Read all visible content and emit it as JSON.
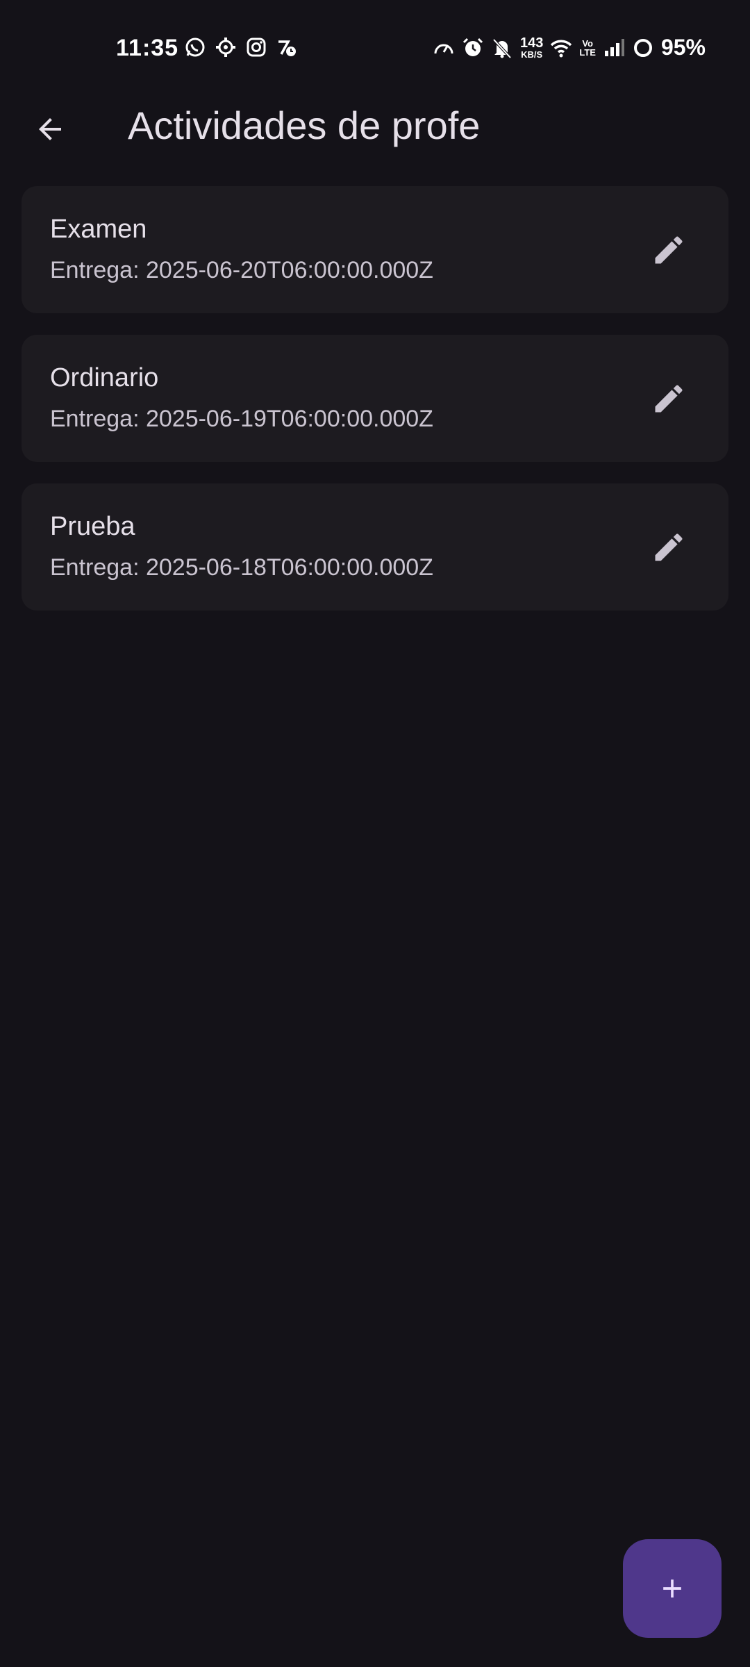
{
  "status_bar": {
    "time": "11:35",
    "left_icons": [
      "whatsapp-icon",
      "settings-gear-icon",
      "instagram-icon",
      "clock-app-icon"
    ],
    "net_speed_value": "143",
    "net_speed_unit": "KB/S",
    "volte_top": "Vo",
    "volte_bottom": "LTE",
    "battery_percent": "95%"
  },
  "app_bar": {
    "title": "Actividades de profe"
  },
  "activities": [
    {
      "name": "Examen",
      "due": "Entrega: 2025-06-20T06:00:00.000Z"
    },
    {
      "name": "Ordinario",
      "due": "Entrega: 2025-06-19T06:00:00.000Z"
    },
    {
      "name": "Prueba",
      "due": "Entrega: 2025-06-18T06:00:00.000Z"
    }
  ],
  "colors": {
    "background": "#141218",
    "card": "#1D1B20",
    "fab": "#4F378B",
    "text_primary": "#E6E0E9",
    "text_secondary": "#CAC4D0"
  }
}
